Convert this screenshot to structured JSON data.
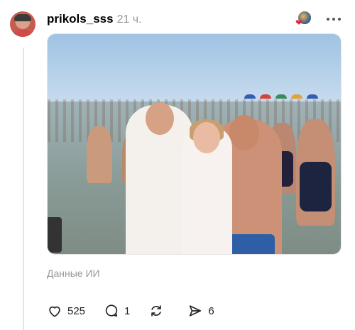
{
  "post": {
    "username": "prikols_sss",
    "time": "21 ч.",
    "ai_label": "Данные ИИ",
    "image_alt_hint": "beach-photo",
    "stats": {
      "likes": "525",
      "replies": "1",
      "reposts": "",
      "shares": "6"
    }
  },
  "icons": {
    "like": "heart-icon",
    "reply": "comment-icon",
    "repost": "repost-icon",
    "share": "send-icon",
    "more": "more-icon"
  },
  "colors": {
    "meta_text": "#999999",
    "heart_badge": "#e5273d",
    "icon_stroke": "#222222"
  }
}
